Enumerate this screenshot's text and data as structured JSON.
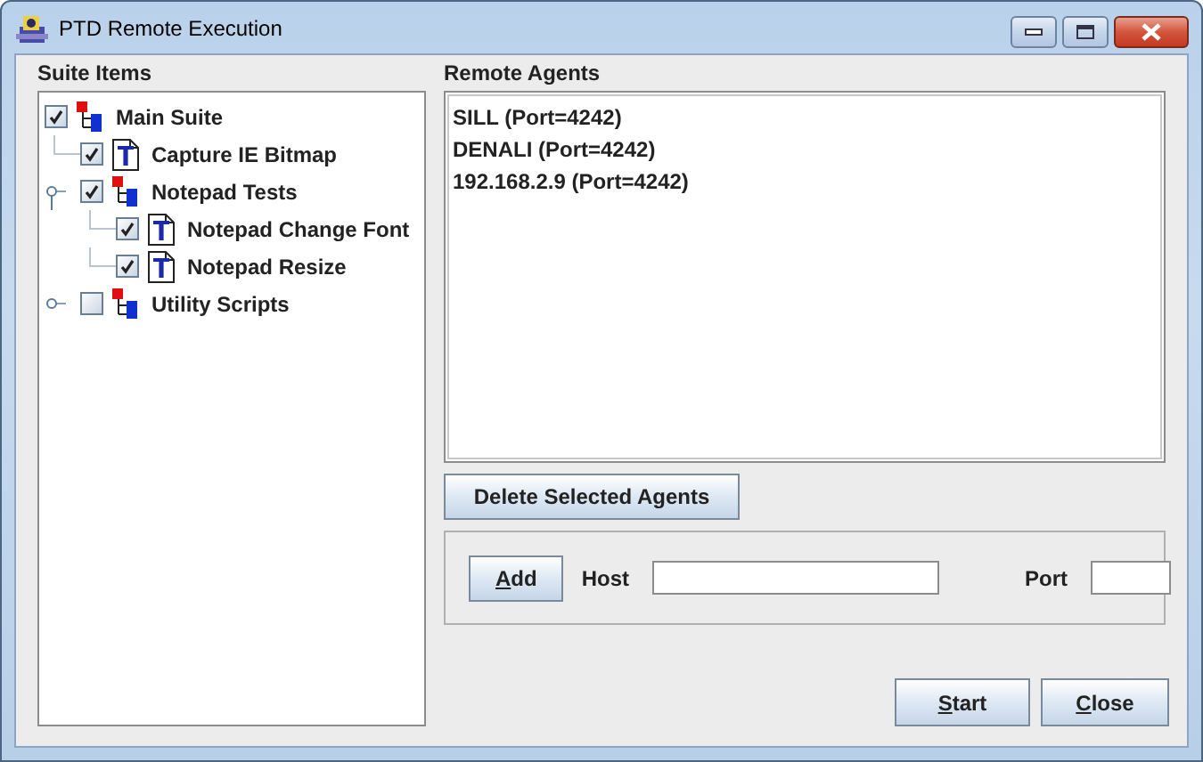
{
  "window": {
    "title": "PTD Remote Execution"
  },
  "suite_items": {
    "label": "Suite Items",
    "tree": [
      {
        "label": "Main Suite",
        "kind": "suite",
        "checked": true,
        "children": [
          {
            "label": "Capture IE Bitmap",
            "kind": "script",
            "checked": true
          },
          {
            "label": "Notepad Tests",
            "kind": "suite",
            "checked": true,
            "expanded": true,
            "children": [
              {
                "label": "Notepad Change Font",
                "kind": "script",
                "checked": true
              },
              {
                "label": "Notepad Resize",
                "kind": "script",
                "checked": true
              }
            ]
          },
          {
            "label": "Utility Scripts",
            "kind": "suite",
            "checked": false,
            "expanded": false
          }
        ]
      }
    ]
  },
  "remote_agents": {
    "label": "Remote Agents",
    "agents": [
      {
        "label": "SILL (Port=4242)",
        "selected": false
      },
      {
        "label": "DENALI (Port=4242)",
        "selected": false
      },
      {
        "label": "192.168.2.9 (Port=4242)",
        "selected": false
      }
    ],
    "delete_button": "Delete Selected Agents"
  },
  "add_agent": {
    "add_button": "Add",
    "host_label": "Host",
    "port_label": "Port"
  },
  "buttons": [
    "Start",
    "Close"
  ]
}
